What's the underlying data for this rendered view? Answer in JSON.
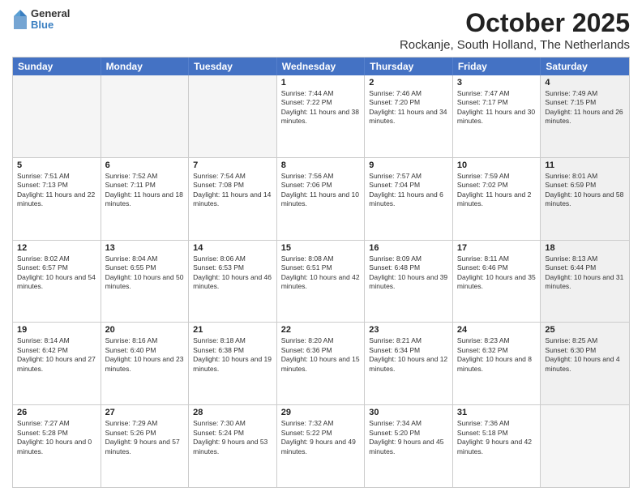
{
  "logo": {
    "general": "General",
    "blue": "Blue"
  },
  "title": "October 2025",
  "subtitle": "Rockanje, South Holland, The Netherlands",
  "days_of_week": [
    "Sunday",
    "Monday",
    "Tuesday",
    "Wednesday",
    "Thursday",
    "Friday",
    "Saturday"
  ],
  "weeks": [
    [
      {
        "day": "",
        "text": "",
        "empty": true
      },
      {
        "day": "",
        "text": "",
        "empty": true
      },
      {
        "day": "",
        "text": "",
        "empty": true
      },
      {
        "day": "1",
        "text": "Sunrise: 7:44 AM\nSunset: 7:22 PM\nDaylight: 11 hours and 38 minutes."
      },
      {
        "day": "2",
        "text": "Sunrise: 7:46 AM\nSunset: 7:20 PM\nDaylight: 11 hours and 34 minutes."
      },
      {
        "day": "3",
        "text": "Sunrise: 7:47 AM\nSunset: 7:17 PM\nDaylight: 11 hours and 30 minutes."
      },
      {
        "day": "4",
        "text": "Sunrise: 7:49 AM\nSunset: 7:15 PM\nDaylight: 11 hours and 26 minutes.",
        "shaded": true
      }
    ],
    [
      {
        "day": "5",
        "text": "Sunrise: 7:51 AM\nSunset: 7:13 PM\nDaylight: 11 hours and 22 minutes."
      },
      {
        "day": "6",
        "text": "Sunrise: 7:52 AM\nSunset: 7:11 PM\nDaylight: 11 hours and 18 minutes."
      },
      {
        "day": "7",
        "text": "Sunrise: 7:54 AM\nSunset: 7:08 PM\nDaylight: 11 hours and 14 minutes."
      },
      {
        "day": "8",
        "text": "Sunrise: 7:56 AM\nSunset: 7:06 PM\nDaylight: 11 hours and 10 minutes."
      },
      {
        "day": "9",
        "text": "Sunrise: 7:57 AM\nSunset: 7:04 PM\nDaylight: 11 hours and 6 minutes."
      },
      {
        "day": "10",
        "text": "Sunrise: 7:59 AM\nSunset: 7:02 PM\nDaylight: 11 hours and 2 minutes."
      },
      {
        "day": "11",
        "text": "Sunrise: 8:01 AM\nSunset: 6:59 PM\nDaylight: 10 hours and 58 minutes.",
        "shaded": true
      }
    ],
    [
      {
        "day": "12",
        "text": "Sunrise: 8:02 AM\nSunset: 6:57 PM\nDaylight: 10 hours and 54 minutes."
      },
      {
        "day": "13",
        "text": "Sunrise: 8:04 AM\nSunset: 6:55 PM\nDaylight: 10 hours and 50 minutes."
      },
      {
        "day": "14",
        "text": "Sunrise: 8:06 AM\nSunset: 6:53 PM\nDaylight: 10 hours and 46 minutes."
      },
      {
        "day": "15",
        "text": "Sunrise: 8:08 AM\nSunset: 6:51 PM\nDaylight: 10 hours and 42 minutes."
      },
      {
        "day": "16",
        "text": "Sunrise: 8:09 AM\nSunset: 6:48 PM\nDaylight: 10 hours and 39 minutes."
      },
      {
        "day": "17",
        "text": "Sunrise: 8:11 AM\nSunset: 6:46 PM\nDaylight: 10 hours and 35 minutes."
      },
      {
        "day": "18",
        "text": "Sunrise: 8:13 AM\nSunset: 6:44 PM\nDaylight: 10 hours and 31 minutes.",
        "shaded": true
      }
    ],
    [
      {
        "day": "19",
        "text": "Sunrise: 8:14 AM\nSunset: 6:42 PM\nDaylight: 10 hours and 27 minutes."
      },
      {
        "day": "20",
        "text": "Sunrise: 8:16 AM\nSunset: 6:40 PM\nDaylight: 10 hours and 23 minutes."
      },
      {
        "day": "21",
        "text": "Sunrise: 8:18 AM\nSunset: 6:38 PM\nDaylight: 10 hours and 19 minutes."
      },
      {
        "day": "22",
        "text": "Sunrise: 8:20 AM\nSunset: 6:36 PM\nDaylight: 10 hours and 15 minutes."
      },
      {
        "day": "23",
        "text": "Sunrise: 8:21 AM\nSunset: 6:34 PM\nDaylight: 10 hours and 12 minutes."
      },
      {
        "day": "24",
        "text": "Sunrise: 8:23 AM\nSunset: 6:32 PM\nDaylight: 10 hours and 8 minutes."
      },
      {
        "day": "25",
        "text": "Sunrise: 8:25 AM\nSunset: 6:30 PM\nDaylight: 10 hours and 4 minutes.",
        "shaded": true
      }
    ],
    [
      {
        "day": "26",
        "text": "Sunrise: 7:27 AM\nSunset: 5:28 PM\nDaylight: 10 hours and 0 minutes."
      },
      {
        "day": "27",
        "text": "Sunrise: 7:29 AM\nSunset: 5:26 PM\nDaylight: 9 hours and 57 minutes."
      },
      {
        "day": "28",
        "text": "Sunrise: 7:30 AM\nSunset: 5:24 PM\nDaylight: 9 hours and 53 minutes."
      },
      {
        "day": "29",
        "text": "Sunrise: 7:32 AM\nSunset: 5:22 PM\nDaylight: 9 hours and 49 minutes."
      },
      {
        "day": "30",
        "text": "Sunrise: 7:34 AM\nSunset: 5:20 PM\nDaylight: 9 hours and 45 minutes."
      },
      {
        "day": "31",
        "text": "Sunrise: 7:36 AM\nSunset: 5:18 PM\nDaylight: 9 hours and 42 minutes."
      },
      {
        "day": "",
        "text": "",
        "empty": true
      }
    ]
  ]
}
